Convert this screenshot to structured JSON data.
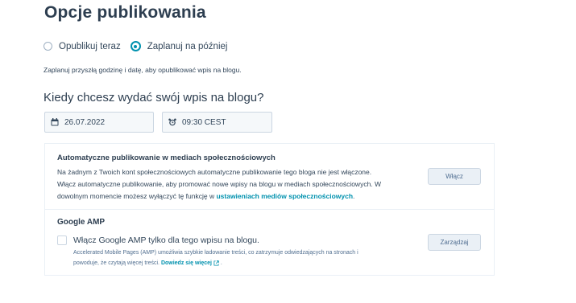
{
  "page": {
    "title": "Opcje publikowania"
  },
  "publish_mode": {
    "options": [
      {
        "label": "Opublikuj teraz",
        "selected": false
      },
      {
        "label": "Zaplanuj na później",
        "selected": true
      }
    ],
    "description": "Zaplanuj przyszłą godzinę i datę, aby opublikować wpis na blogu."
  },
  "schedule": {
    "heading": "Kiedy chcesz wydać swój wpis na blogu?",
    "date": "26.07.2022",
    "time": "09:30 CEST",
    "date_icon": "calendar-icon",
    "time_icon": "alarm-clock-icon"
  },
  "social": {
    "title": "Automatyczne publikowanie w mediach społecznościowych",
    "line1": "Na żadnym z Twoich kont społecznościowych automatyczne publikowanie tego bloga nie jest włączone.",
    "line2": "Włącz automatyczne publikowanie, aby promować nowe wpisy na blogu w mediach społecznościowych. W",
    "line3_prefix": "dowolnym momencie możesz wyłączyć tę funkcję w ",
    "line3_link": "ustawieniach mediów społecznościowych",
    "line3_suffix": ".",
    "button": "Włącz"
  },
  "amp": {
    "title": "Google AMP",
    "checkbox_label": "Włącz Google AMP tylko dla tego wpisu na blogu.",
    "checked": false,
    "help_line1": "Accelerated Mobile Pages (AMP) umożliwia szybkie ładowanie treści, co zatrzymuje odwiedzających na stronach i",
    "help_line2": "powoduje, że czytają więcej treści. ",
    "help_link": "Dowiedz się więcej",
    "help_suffix": " .",
    "link_icon": "external-link-icon",
    "button": "Zarządzaj"
  },
  "colors": {
    "accent": "#0091ae",
    "text": "#33475b",
    "heading": "#2d3e50",
    "field_bg": "#f5f8fa",
    "border": "#cbd6e2"
  }
}
